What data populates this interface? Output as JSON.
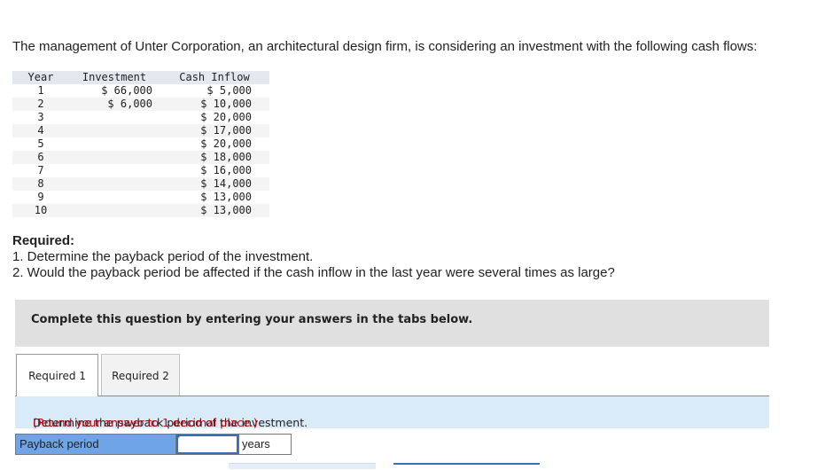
{
  "intro": "The management of Unter Corporation, an architectural design firm, is considering an investment with the following cash flows:",
  "table": {
    "headers": [
      "Year",
      "Investment",
      "Cash Inflow"
    ],
    "rows": [
      {
        "year": "1",
        "investment": "$ 66,000",
        "cash_inflow": "$ 5,000"
      },
      {
        "year": "2",
        "investment": "$ 6,000",
        "cash_inflow": "$ 10,000"
      },
      {
        "year": "3",
        "investment": "",
        "cash_inflow": "$ 20,000"
      },
      {
        "year": "4",
        "investment": "",
        "cash_inflow": "$ 17,000"
      },
      {
        "year": "5",
        "investment": "",
        "cash_inflow": "$ 20,000"
      },
      {
        "year": "6",
        "investment": "",
        "cash_inflow": "$ 18,000"
      },
      {
        "year": "7",
        "investment": "",
        "cash_inflow": "$ 16,000"
      },
      {
        "year": "8",
        "investment": "",
        "cash_inflow": "$ 14,000"
      },
      {
        "year": "9",
        "investment": "",
        "cash_inflow": "$ 13,000"
      },
      {
        "year": "10",
        "investment": "",
        "cash_inflow": "$ 13,000"
      }
    ]
  },
  "required": {
    "title": "Required:",
    "items": [
      "1. Determine the payback period of the investment.",
      "2. Would the payback period be affected if the cash inflow in the last year were several times as large?"
    ]
  },
  "banner": "Complete this question by entering your answers in the tabs below.",
  "tabs": [
    {
      "label": "Required 1",
      "active": true
    },
    {
      "label": "Required 2",
      "active": false
    }
  ],
  "instruction": {
    "text": "Determine the payback period of the investment.",
    "note": "(Round your answer to 1 decimal place.)"
  },
  "answer": {
    "label": "Payback period",
    "value": "",
    "unit": "years"
  }
}
